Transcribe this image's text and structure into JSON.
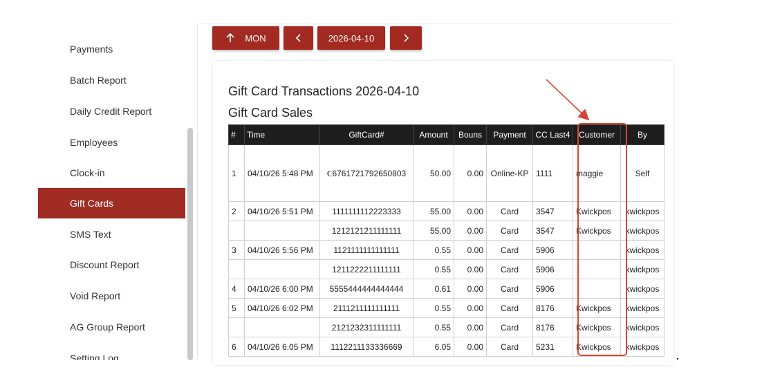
{
  "sidebar": {
    "items": [
      {
        "label": "Payments"
      },
      {
        "label": "Batch Report"
      },
      {
        "label": "Daily Credit Report"
      },
      {
        "label": "Employees"
      },
      {
        "label": "Clock-in"
      },
      {
        "label": "Gift Cards",
        "active": true
      },
      {
        "label": "SMS Text"
      },
      {
        "label": "Discount Report"
      },
      {
        "label": "Void Report"
      },
      {
        "label": "AG Group Report"
      },
      {
        "label": "Setting Log"
      }
    ]
  },
  "nav": {
    "period_label": "MON",
    "period_icon": "arrow-up-icon",
    "prev_icon": "chevron-left-icon",
    "date": "2026-04-10",
    "next_icon": "chevron-right-icon"
  },
  "report": {
    "title": "Gift Card Transactions 2026-04-10",
    "section_title": "Gift Card Sales",
    "columns": [
      "#",
      "Time",
      "GiftCard#",
      "Amount",
      "Bouns",
      "Payment",
      "CC Last4",
      "Customer",
      "By"
    ],
    "rows": [
      {
        "num": "1",
        "time": "04/10/26 5:48 PM",
        "card": "6761721792650803",
        "card_icon": "gift-card-link-icon",
        "amount": "50.00",
        "bonus": "0.00",
        "payment": "Online-KP",
        "cc": "1111",
        "customer": "maggie",
        "by": "Self"
      },
      {
        "num": "2",
        "time": "04/10/26 5:51 PM",
        "card": "1111111112223333",
        "amount": "55.00",
        "bonus": "0.00",
        "payment": "Card",
        "cc": "3547",
        "customer": "Kwickpos",
        "by": "kwickpos"
      },
      {
        "num": "",
        "time": "",
        "card": "1212121211111111",
        "amount": "55.00",
        "bonus": "0.00",
        "payment": "Card",
        "cc": "3547",
        "customer": "Kwickpos",
        "by": "kwickpos"
      },
      {
        "num": "3",
        "time": "04/10/26 5:56 PM",
        "card": "1121111111111111",
        "amount": "0.55",
        "bonus": "0.00",
        "payment": "Card",
        "cc": "5906",
        "customer": "",
        "by": "kwickpos"
      },
      {
        "num": "",
        "time": "",
        "card": "1211222211111111",
        "amount": "0.55",
        "bonus": "0.00",
        "payment": "Card",
        "cc": "5906",
        "customer": "",
        "by": "kwickpos"
      },
      {
        "num": "4",
        "time": "04/10/26 6:00 PM",
        "card": "5555444444444444",
        "amount": "0.61",
        "bonus": "0.00",
        "payment": "Card",
        "cc": "5906",
        "customer": "",
        "by": "kwickpos"
      },
      {
        "num": "5",
        "time": "04/10/26 6:02 PM",
        "card": "2111211111111111",
        "amount": "0.55",
        "bonus": "0.00",
        "payment": "Card",
        "cc": "8176",
        "customer": "Kwickpos",
        "by": "kwickpos"
      },
      {
        "num": "",
        "time": "",
        "card": "2121232311111111",
        "amount": "0.55",
        "bonus": "0.00",
        "payment": "Card",
        "cc": "8176",
        "customer": "Kwickpos",
        "by": "kwickpos"
      },
      {
        "num": "6",
        "time": "04/10/26 6:05 PM",
        "card": "1112211133336669",
        "amount": "6.05",
        "bonus": "0.00",
        "payment": "Card",
        "cc": "5231",
        "customer": "Kwickpos",
        "by": "kwickpos"
      }
    ]
  },
  "colors": {
    "accent": "#a32a21",
    "annotation": "#d64534",
    "header_bg": "#1d1d1d"
  }
}
